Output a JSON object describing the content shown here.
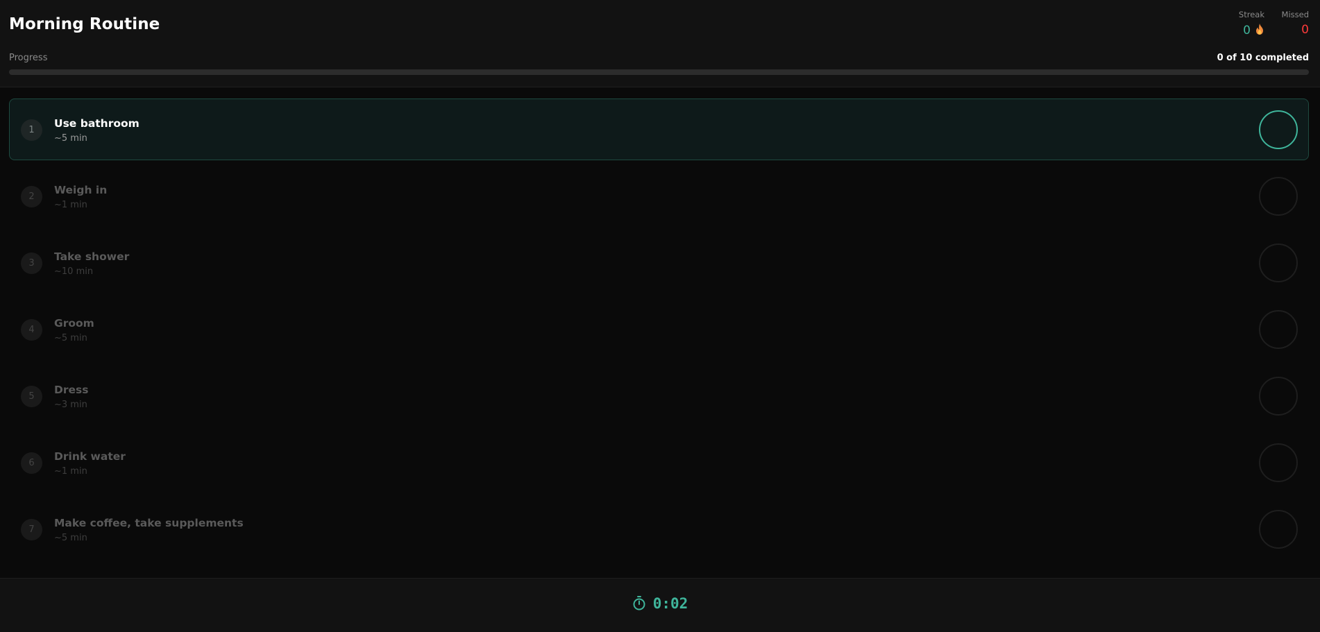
{
  "header": {
    "title": "Morning Routine",
    "streak": {
      "label": "Streak",
      "value": "0",
      "icon": "flame-icon"
    },
    "missed": {
      "label": "Missed",
      "value": "0"
    },
    "progress": {
      "label": "Progress",
      "text": "0 of 10 completed",
      "fraction": 0
    }
  },
  "tasks": [
    {
      "num": "1",
      "name": "Use bathroom",
      "duration": "~5 min",
      "active": true
    },
    {
      "num": "2",
      "name": "Weigh in",
      "duration": "~1 min",
      "active": false
    },
    {
      "num": "3",
      "name": "Take shower",
      "duration": "~10 min",
      "active": false
    },
    {
      "num": "4",
      "name": "Groom",
      "duration": "~5 min",
      "active": false
    },
    {
      "num": "5",
      "name": "Dress",
      "duration": "~3 min",
      "active": false
    },
    {
      "num": "6",
      "name": "Drink water",
      "duration": "~1 min",
      "active": false
    },
    {
      "num": "7",
      "name": "Make coffee, take supplements",
      "duration": "~5 min",
      "active": false
    }
  ],
  "footer": {
    "timer": "0:02",
    "icon": "stopwatch-icon"
  },
  "colors": {
    "accent": "#3fb59b",
    "danger": "#ff3b3b",
    "background": "#0a0a0a"
  }
}
